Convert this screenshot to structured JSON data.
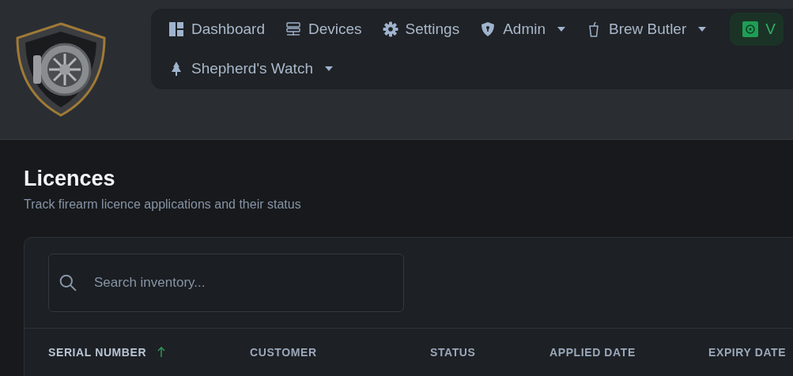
{
  "nav": {
    "items": [
      {
        "label": "Dashboard",
        "dropdown": false,
        "selected": false
      },
      {
        "label": "Devices",
        "dropdown": false,
        "selected": false
      },
      {
        "label": "Settings",
        "dropdown": false,
        "selected": false
      },
      {
        "label": "Admin",
        "dropdown": true,
        "selected": false
      },
      {
        "label": "Brew Butler",
        "dropdown": true,
        "selected": false
      },
      {
        "label": "V",
        "dropdown": false,
        "selected": true
      },
      {
        "label": "Shepherd's Watch",
        "dropdown": true,
        "selected": false
      }
    ]
  },
  "page": {
    "title": "Licences",
    "subtitle": "Track firearm licence applications and their status"
  },
  "search": {
    "placeholder": "Search inventory..."
  },
  "table": {
    "columns": [
      {
        "label": "SERIAL NUMBER",
        "sorted": true
      },
      {
        "label": "CUSTOMER",
        "sorted": false
      },
      {
        "label": "STATUS",
        "sorted": false
      },
      {
        "label": "APPLIED DATE",
        "sorted": false
      },
      {
        "label": "EXPIRY DATE",
        "sorted": false
      }
    ]
  }
}
